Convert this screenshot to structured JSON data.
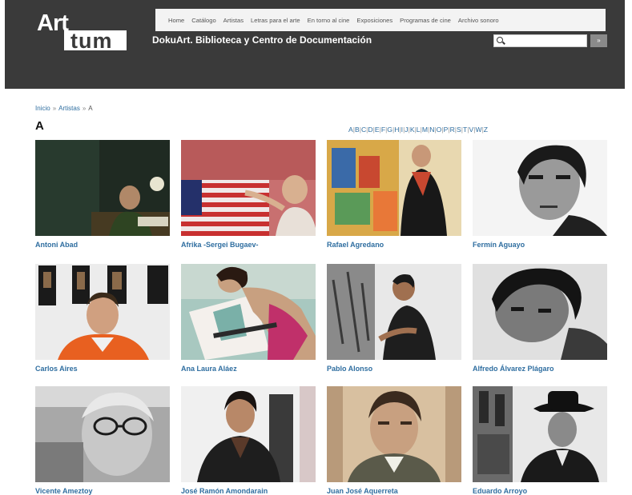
{
  "logo": {
    "top": "Art",
    "bottom": "tum"
  },
  "nav": [
    "Home",
    "Catálogo",
    "Artistas",
    "Letras para el arte",
    "En torno al cine",
    "Exposiciones",
    "Programas de cine",
    "Archivo sonoro"
  ],
  "site_title": "DokuArt. Biblioteca y Centro de Documentación",
  "search": {
    "value": "",
    "placeholder": "",
    "button_label": "»"
  },
  "breadcrumb": {
    "home": "Inicio",
    "artists": "Artistas",
    "current": "A",
    "separator": "»"
  },
  "page_letter": "A",
  "alphabet": [
    "A",
    "B",
    "C",
    "D",
    "E",
    "F",
    "G",
    "H",
    "I",
    "J",
    "K",
    "L",
    "M",
    "N",
    "O",
    "P",
    "R",
    "S",
    "T",
    "V",
    "W",
    "Z"
  ],
  "artists": [
    {
      "name": "Antoni Abad"
    },
    {
      "name": "Afrika -Sergei Bugaev-"
    },
    {
      "name": "Rafael Agredano"
    },
    {
      "name": "Fermín Aguayo"
    },
    {
      "name": "Carlos Aires"
    },
    {
      "name": "Ana Laura Aláez"
    },
    {
      "name": "Pablo Alonso"
    },
    {
      "name": "Alfredo Álvarez Plágaro"
    },
    {
      "name": "Vicente Ameztoy"
    },
    {
      "name": "José Ramón Amondarain"
    },
    {
      "name": "Juan José Aquerreta"
    },
    {
      "name": "Eduardo Arroyo"
    }
  ]
}
